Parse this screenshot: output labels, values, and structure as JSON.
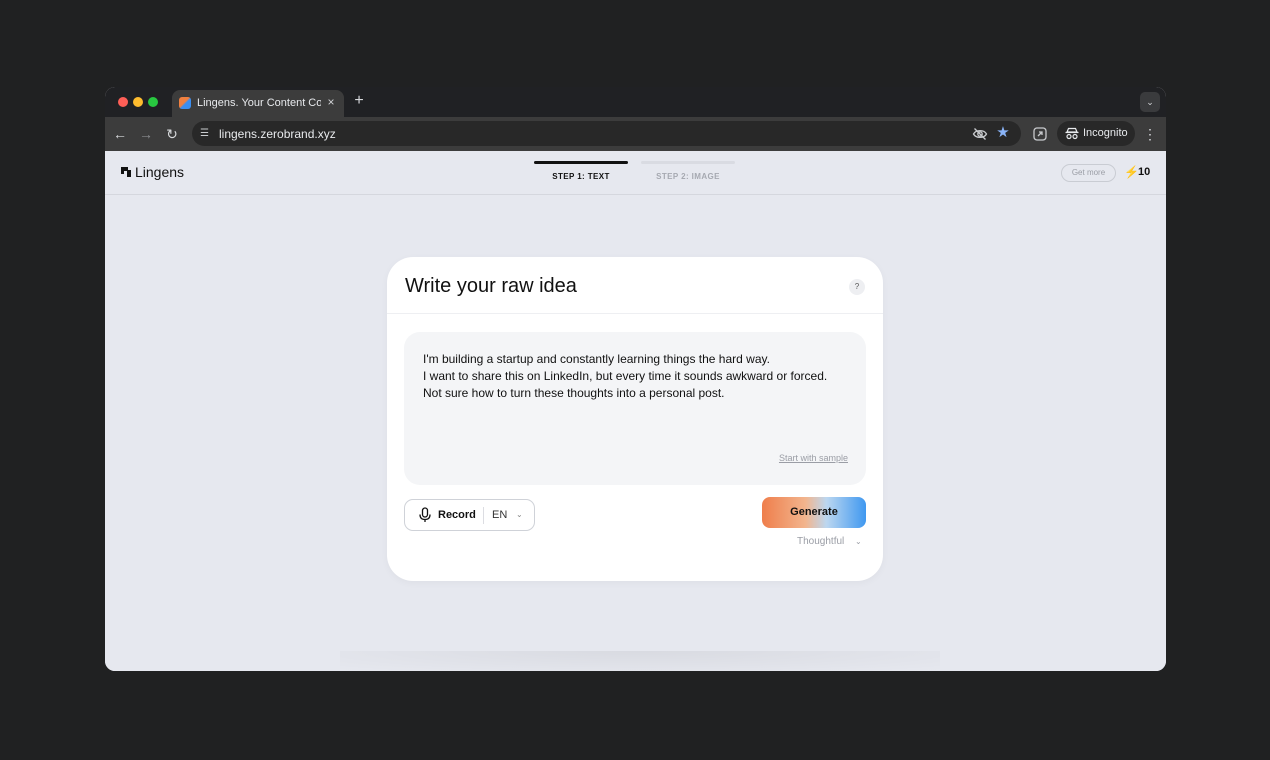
{
  "browser": {
    "tab_title": "Lingens. Your Content Copilot",
    "tab_close": "×",
    "new_tab": "+",
    "url": "lingens.zerobrand.xyz",
    "incognito_label": "Incognito"
  },
  "app": {
    "logo_text": "Lingens",
    "steps": [
      {
        "label": "STEP 1: TEXT",
        "active": true
      },
      {
        "label": "STEP 2: IMAGE",
        "active": false
      }
    ],
    "get_more_label": "Get more",
    "credits": "10"
  },
  "card": {
    "title": "Write your raw idea",
    "help_label": "?",
    "idea_text": "I'm building a startup and constantly learning things the hard way.\nI want to share this on LinkedIn, but every time it sounds awkward or forced.\nNot sure how to turn these thoughts into a personal post.",
    "sample_link": "Start with sample",
    "record_label": "Record",
    "language": "EN",
    "generate_label": "Generate",
    "tone": "Thoughtful"
  },
  "colors": {
    "accent_orange": "#ef7e4b",
    "accent_blue": "#3f98f0",
    "bolt": "#f5b700"
  }
}
